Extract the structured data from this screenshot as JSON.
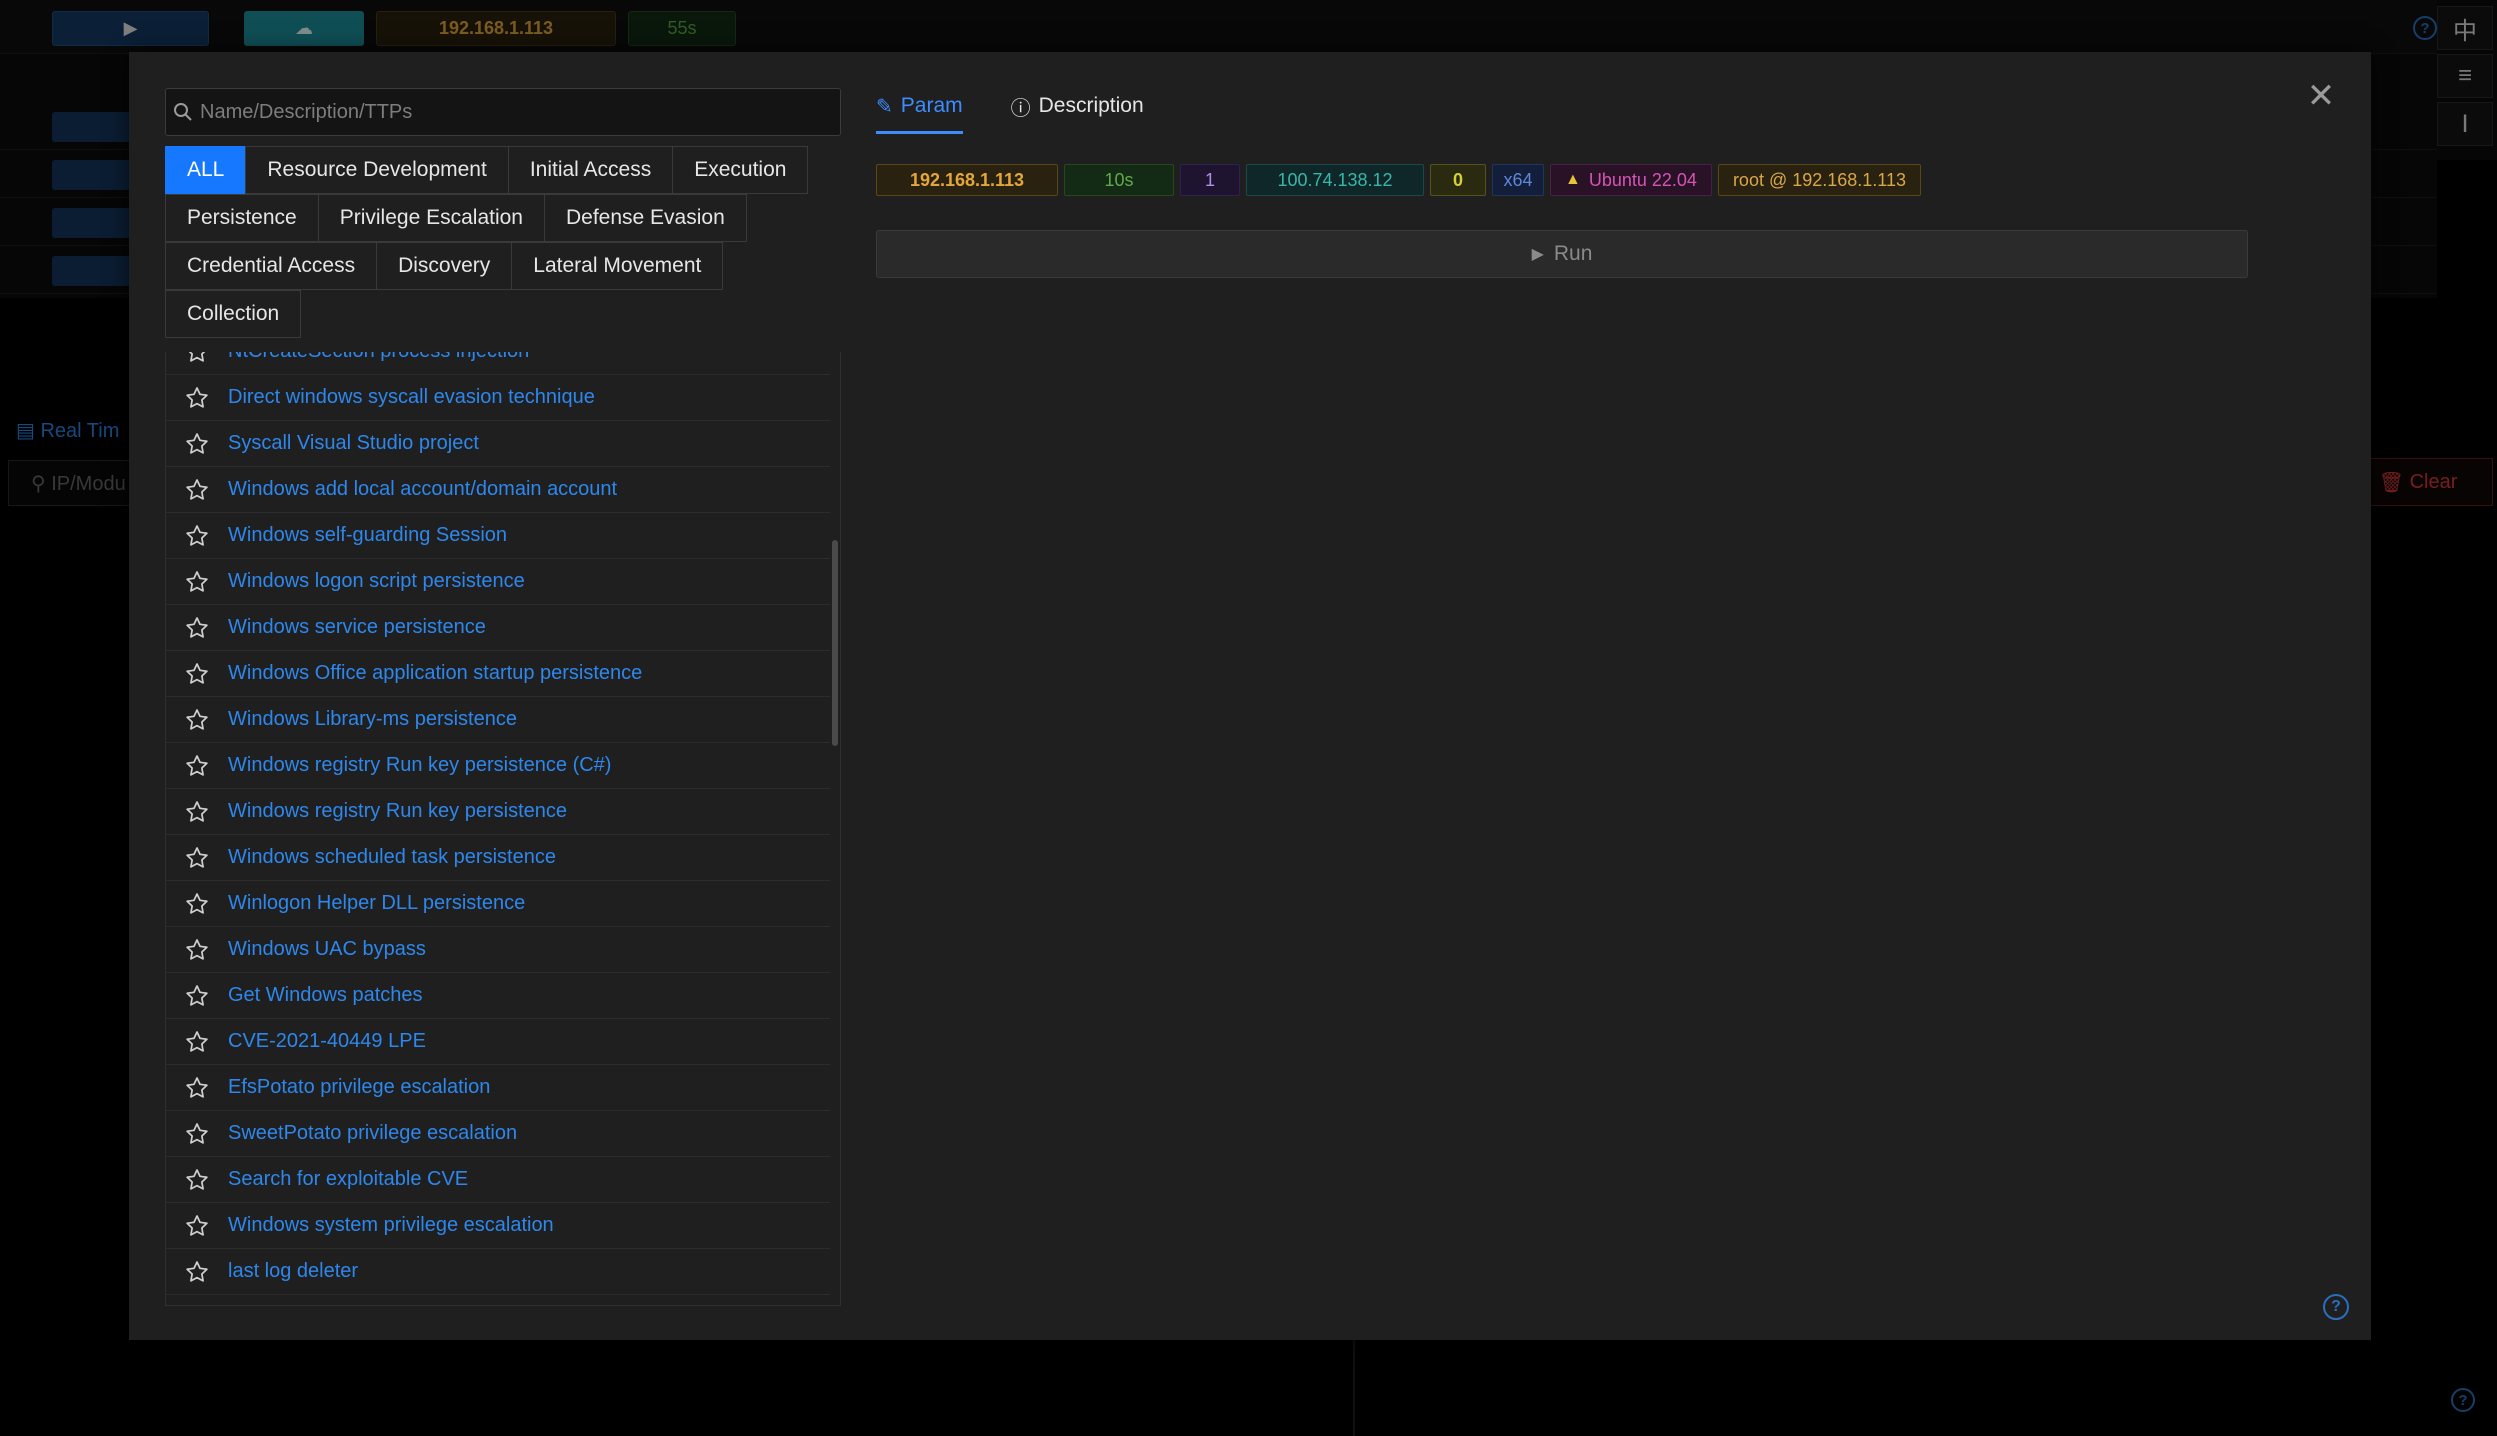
{
  "topbar": {
    "play_glyph": "▶",
    "cloud_glyph": "☁",
    "ip": "192.168.1.113",
    "timer": "55s",
    "help_glyph": "?"
  },
  "side_buttons": [
    "中",
    "≡",
    "Ⅰ"
  ],
  "background": {
    "realtime_label": "Real Tim",
    "search_placeholder": "IP/Modu",
    "clear_label": "Clear"
  },
  "modal": {
    "search_placeholder": "Name/Description/TTPs",
    "close_glyph": "✕",
    "help_glyph": "?",
    "tags": [
      {
        "label": "ALL",
        "active": true
      },
      {
        "label": "Resource Development"
      },
      {
        "label": "Initial Access"
      },
      {
        "label": "Execution"
      },
      {
        "label": "Persistence"
      },
      {
        "label": "Privilege Escalation"
      },
      {
        "label": "Defense Evasion"
      },
      {
        "label": "Credential Access"
      },
      {
        "label": "Discovery"
      },
      {
        "label": "Lateral Movement"
      },
      {
        "label": "Collection"
      }
    ],
    "modules": [
      "NtCreateSection process injection",
      "Direct windows syscall evasion technique",
      "Syscall Visual Studio project",
      "Windows add local account/domain account",
      "Windows self-guarding Session",
      "Windows logon script persistence",
      "Windows service persistence",
      "Windows Office application startup persistence",
      "Windows Library-ms persistence",
      "Windows registry Run key persistence (C#)",
      "Windows registry Run key persistence",
      "Windows scheduled task persistence",
      "Winlogon Helper DLL persistence",
      "Windows UAC bypass",
      "Get Windows patches",
      "CVE-2021-40449 LPE",
      "EfsPotato privilege escalation",
      "SweetPotato privilege escalation",
      "Search for exploitable CVE",
      "Windows system privilege escalation",
      "last log deleter"
    ],
    "tabs": {
      "param": "Param",
      "description": "Description"
    },
    "session": {
      "ip": "192.168.1.113",
      "interval": "10s",
      "count": "1",
      "public_ip": "100.74.138.12",
      "zero": "0",
      "arch": "x64",
      "os": "Ubuntu 22.04",
      "user": "root @ 192.168.1.113"
    },
    "run_label": "Run"
  },
  "colors": {
    "accent": "#1677ff",
    "link": "#2e87ec",
    "danger": "#d33a3a"
  }
}
